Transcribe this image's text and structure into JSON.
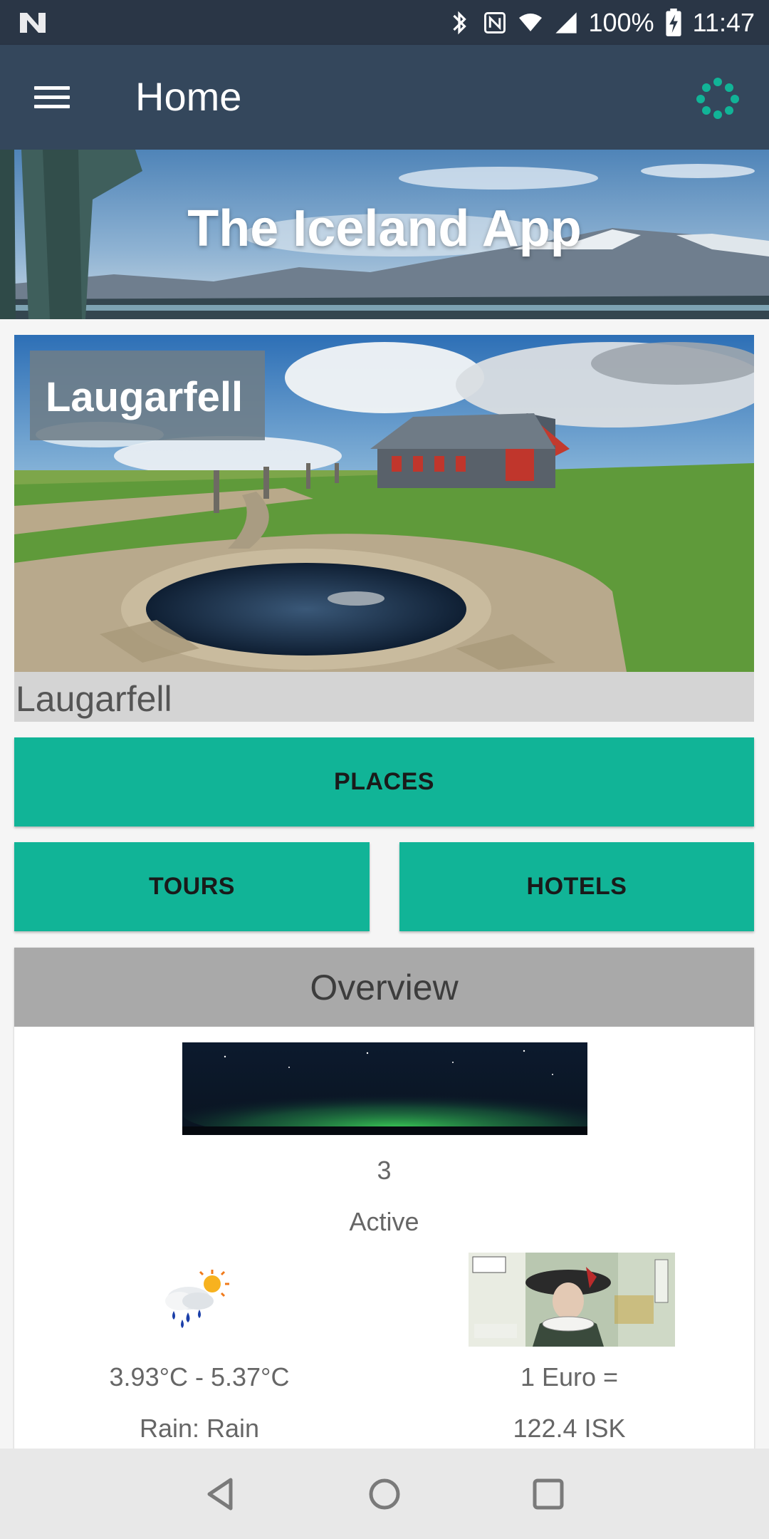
{
  "status_bar": {
    "battery": "100%",
    "time": "11:47",
    "icons": [
      "n-logo-icon",
      "bluetooth-icon",
      "nfc-icon",
      "wifi-icon",
      "signal-icon",
      "battery-charging-icon"
    ]
  },
  "app_bar": {
    "title": "Home",
    "menu_icon": "hamburger-menu-icon",
    "action_icon": "dots-circle-icon"
  },
  "banner": {
    "title": "The Iceland App"
  },
  "featured": {
    "overlay_title": "Laugarfell",
    "caption": "Laugarfell"
  },
  "buttons": {
    "places": "PLACES",
    "tours": "TOURS",
    "hotels": "HOTELS"
  },
  "overview": {
    "title": "Overview",
    "aurora_value": "3",
    "aurora_status": "Active",
    "temperature_range": "3.93°C - 5.37°C",
    "weather_description": "Rain: Rain",
    "currency_line1": "1 Euro =",
    "currency_line2": "122.4 ISK"
  },
  "colors": {
    "status_bar": "#2a3646",
    "app_bar": "#34475c",
    "accent": "#11b497",
    "overview_header": "#a9a9a9",
    "nav_bar": "#e8e8e8"
  }
}
